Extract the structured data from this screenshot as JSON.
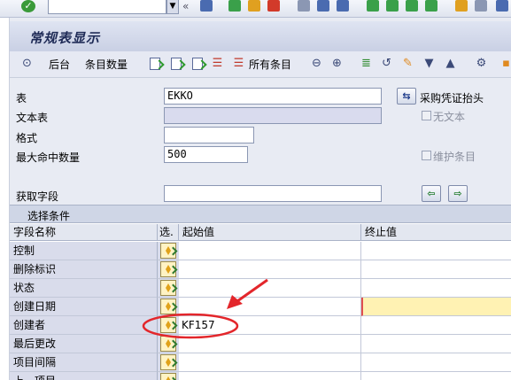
{
  "app": {
    "title": "常规表显示"
  },
  "toolbar": {
    "back_label": "后台",
    "count_label": "条目数量",
    "all_entries_label": "所有条目"
  },
  "form": {
    "table_label": "表",
    "table_value": "EKKO",
    "table_desc": "采购凭证抬头",
    "text_table_label": "文本表",
    "text_table_value": "",
    "no_text_label": "无文本",
    "format_label": "格式",
    "format_value": "",
    "max_hits_label": "最大命中数量",
    "max_hits_value": "500",
    "maintain_label": "维护条目",
    "fetch_fields_label": "获取字段",
    "fetch_fields_value": ""
  },
  "selection": {
    "title": "选择条件",
    "columns": {
      "field": "字段名称",
      "sel": "选.",
      "from": "起始值",
      "to": "终止值"
    },
    "rows": [
      {
        "name": "控制",
        "from": ""
      },
      {
        "name": "删除标识",
        "from": ""
      },
      {
        "name": "状态",
        "from": ""
      },
      {
        "name": "创建日期",
        "from": ""
      },
      {
        "name": "创建者",
        "from": "KF157"
      },
      {
        "name": "最后更改",
        "from": ""
      },
      {
        "name": "项目间隔",
        "from": ""
      },
      {
        "name": "上一项目",
        "from": ""
      }
    ]
  },
  "colors": {
    "title_bg": "#c9d0e4",
    "highlight_cell": "#fff2b3",
    "annotation_red": "#e3262b"
  }
}
